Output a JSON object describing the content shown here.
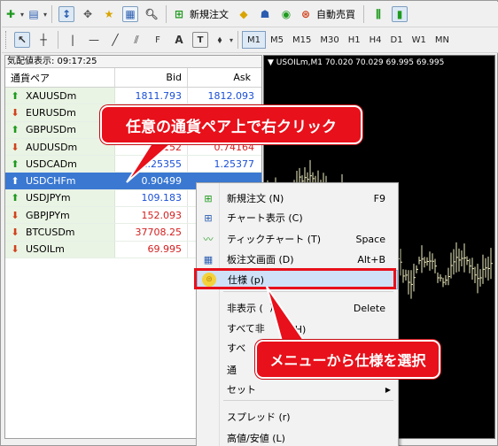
{
  "toolbar1": {
    "new_order_label": "新規注文",
    "auto_trade_label": "自動売買"
  },
  "toolbar2": {
    "text_tool": "A",
    "timeframes": [
      "M1",
      "M5",
      "M15",
      "M30",
      "H1",
      "H4",
      "D1",
      "W1",
      "MN"
    ],
    "selected_timeframe": "M1"
  },
  "market_watch": {
    "title": "気配値表示: 09:17:25",
    "headers": {
      "symbol": "通貨ペア",
      "bid": "Bid",
      "ask": "Ask"
    },
    "rows": [
      {
        "symbol": "XAUUSDm",
        "bid": "1811.793",
        "ask": "1812.093",
        "dir": "up",
        "color": "blue"
      },
      {
        "symbol": "EURUSDm",
        "bid": "",
        "ask": "",
        "dir": "down",
        "color": "blue"
      },
      {
        "symbol": "GBPUSDm",
        "bid": "",
        "ask": "",
        "dir": "up",
        "color": "blue"
      },
      {
        "symbol": "AUDUSDm",
        "bid": "4152",
        "ask": "0.74164",
        "dir": "down",
        "color": "red"
      },
      {
        "symbol": "USDCADm",
        "bid": "1.25355",
        "ask": "1.25377",
        "dir": "up",
        "color": "blue"
      },
      {
        "symbol": "USDCHFm",
        "bid": "0.90499",
        "ask": "",
        "dir": "up",
        "color": "white",
        "selected": true
      },
      {
        "symbol": "USDJPYm",
        "bid": "109.183",
        "ask": "",
        "dir": "up",
        "color": "blue"
      },
      {
        "symbol": "GBPJPYm",
        "bid": "152.093",
        "ask": "",
        "dir": "down",
        "color": "red"
      },
      {
        "symbol": "BTCUSDm",
        "bid": "37708.25",
        "ask": "",
        "dir": "down",
        "color": "red"
      },
      {
        "symbol": "USOILm",
        "bid": "69.995",
        "ask": "",
        "dir": "down",
        "color": "red"
      }
    ]
  },
  "chart": {
    "title": "▼ USOILm,M1  70.020 70.029 69.995 69.995"
  },
  "context_menu": {
    "items": [
      {
        "label": "新規注文 (N)",
        "key": "F9",
        "icon": "new-order-icon"
      },
      {
        "label": "チャート表示 (C)",
        "key": "",
        "icon": "chart-window-icon"
      },
      {
        "label": "ティックチャート (T)",
        "key": "Space",
        "icon": "tick-chart-icon"
      },
      {
        "label": "板注文画面 (D)",
        "key": "Alt+B",
        "icon": "depth-of-market-icon"
      },
      {
        "label": "仕様 (p)",
        "key": "",
        "icon": "specification-icon",
        "highlighted": true
      },
      {
        "label": "非表示 (",
        "key": "Delete",
        "icon": ""
      },
      {
        "label": "すべて非",
        "key": "",
        "icon": ""
      },
      {
        "label": "すべ",
        "key": "",
        "icon": ""
      },
      {
        "label": "通",
        "key": "",
        "icon": ""
      },
      {
        "label": "セット",
        "key": "",
        "icon": "",
        "submenu": true
      },
      {
        "label": "スプレッド (r)",
        "key": "",
        "icon": ""
      },
      {
        "label": "高値/安値 (L)",
        "key": "",
        "icon": ""
      }
    ],
    "fragments": {
      "hide_tail": ")",
      "show_all_tail": "示 (H)"
    }
  },
  "callouts": {
    "step1": "任意の通貨ペア上で右クリック",
    "step2": "メニューから仕様を選択"
  },
  "colors": {
    "accent_red": "#e8101a",
    "selection_blue": "#3a78d2",
    "bid_blue": "#1a4fd6",
    "price_red": "#d42020",
    "chart_bg": "#000000",
    "candle_color": "#f2efc2"
  }
}
